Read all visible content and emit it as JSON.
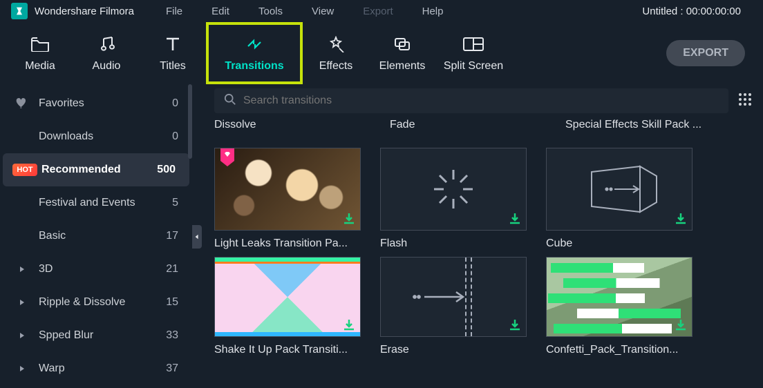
{
  "product": "Wondershare Filmora",
  "menus": [
    "File",
    "Edit",
    "Tools",
    "View",
    "Export",
    "Help"
  ],
  "disabled_menu_index": 4,
  "project_title": "Untitled : 00:00:00:00",
  "export_button": "EXPORT",
  "tools": [
    {
      "key": "media",
      "label": "Media"
    },
    {
      "key": "audio",
      "label": "Audio"
    },
    {
      "key": "titles",
      "label": "Titles"
    },
    {
      "key": "transitions",
      "label": "Transitions"
    },
    {
      "key": "effects",
      "label": "Effects"
    },
    {
      "key": "elements",
      "label": "Elements"
    },
    {
      "key": "splitscreen",
      "label": "Split Screen"
    }
  ],
  "active_tool_index": 3,
  "search": {
    "placeholder": "Search transitions"
  },
  "sidebar": {
    "items": [
      {
        "icon": "heart",
        "label": "Favorites",
        "count": 0
      },
      {
        "icon": "none",
        "label": "Downloads",
        "count": 0
      },
      {
        "icon": "hot",
        "label": "Recommended",
        "count": 500,
        "selected": true
      },
      {
        "icon": "none",
        "label": "Festival and Events",
        "count": 5
      },
      {
        "icon": "none",
        "label": "Basic",
        "count": 17
      },
      {
        "icon": "chev",
        "label": "3D",
        "count": 21
      },
      {
        "icon": "chev",
        "label": "Ripple & Dissolve",
        "count": 15
      },
      {
        "icon": "chev",
        "label": "Spped Blur",
        "count": 33
      },
      {
        "icon": "chev",
        "label": "Warp",
        "count": 37
      }
    ]
  },
  "top_row_labels": [
    "Dissolve",
    "Fade",
    "Special Effects Skill Pack ..."
  ],
  "transitions": {
    "row1": [
      {
        "label": "Light Leaks Transition Pa...",
        "kind": "bokeh",
        "badge": true
      },
      {
        "label": "Flash",
        "kind": "flash"
      },
      {
        "label": "Cube",
        "kind": "cube"
      }
    ],
    "row2": [
      {
        "label": "Shake It Up Pack Transiti...",
        "kind": "shake"
      },
      {
        "label": "Erase",
        "kind": "erase"
      },
      {
        "label": "Confetti_Pack_Transition...",
        "kind": "confetti"
      }
    ]
  }
}
